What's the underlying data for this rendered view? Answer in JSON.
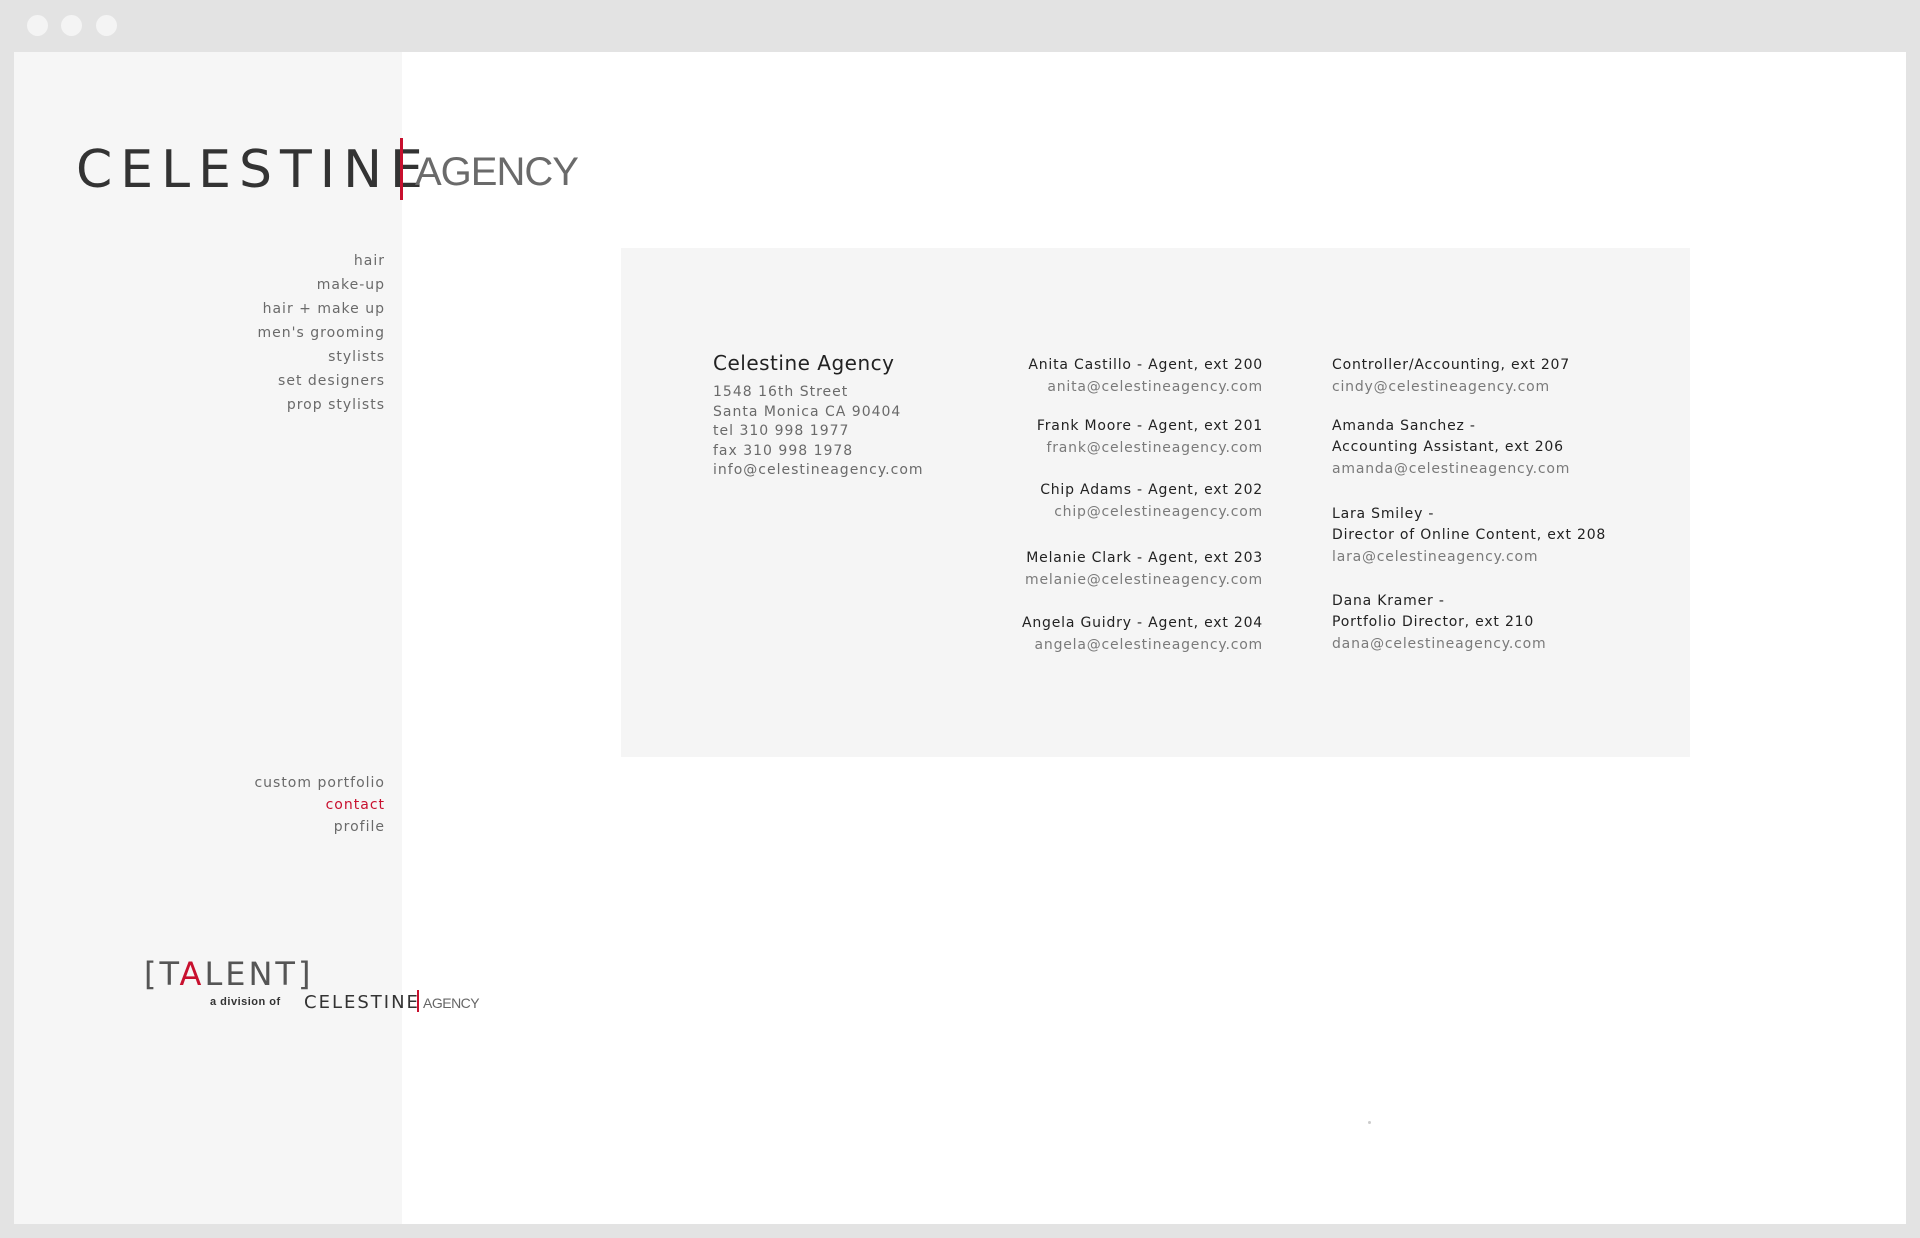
{
  "logo": {
    "main": "CELESTINE",
    "sub": "AGENCY"
  },
  "nav_top": [
    "hair",
    "make-up",
    "hair + make up",
    "men's grooming",
    "stylists",
    "set designers",
    "prop stylists"
  ],
  "nav_bottom": [
    "custom portfolio",
    "contact",
    "profile"
  ],
  "talent": {
    "open": "[",
    "t": "T",
    "a": "A",
    "rest": "LENT",
    "close": "]",
    "division": "a division of",
    "celestine": "CELESTINE",
    "agency": "AGENCY"
  },
  "company": {
    "name": "Celestine Agency",
    "lines": [
      "1548 16th Street",
      "Santa Monica CA 90404",
      "tel 310 998 1977",
      "fax 310 998 1978",
      "info@celestineagency.com"
    ]
  },
  "agents": [
    {
      "name": "Anita Castillo - Agent, ext 200",
      "email": "anita@celestineagency.com"
    },
    {
      "name": "Frank Moore - Agent, ext 201",
      "email": "frank@celestineagency.com"
    },
    {
      "name": "Chip Adams - Agent, ext 202",
      "email": "chip@celestineagency.com"
    },
    {
      "name": "Melanie Clark - Agent, ext 203",
      "email": "melanie@celestineagency.com"
    },
    {
      "name": "Angela Guidry - Agent, ext 204",
      "email": "angela@celestineagency.com"
    }
  ],
  "staff": [
    {
      "name1": "Controller/Accounting, ext 207",
      "name2": "",
      "email": "cindy@celestineagency.com"
    },
    {
      "name1": "Amanda Sanchez -",
      "name2": "Accounting Assistant, ext 206",
      "email": "amanda@celestineagency.com"
    },
    {
      "name1": "Lara Smiley -",
      "name2": "Director of Online Content, ext 208",
      "email": "lara@celestineagency.com"
    },
    {
      "name1": "Dana Kramer -",
      "name2": "Portfolio Director, ext 210",
      "email": "dana@celestineagency.com"
    }
  ],
  "colors": {
    "accent": "#c8102e",
    "sidebar": "#f6f6f6",
    "card": "#f5f5f5",
    "text": "#6a6a6a"
  }
}
